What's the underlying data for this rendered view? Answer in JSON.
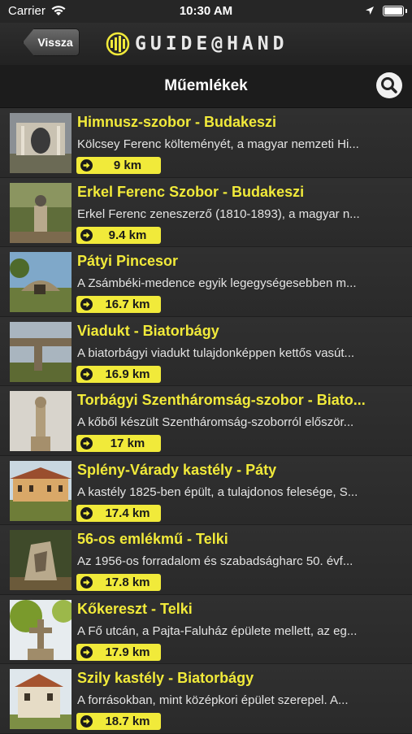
{
  "status": {
    "carrier": "Carrier",
    "time": "10:30 AM"
  },
  "nav": {
    "back_label": "Vissza",
    "logo_text": "GUIDE@HAND"
  },
  "header": {
    "title": "Műemlékek"
  },
  "items": [
    {
      "title": "Himnusz-szobor - Budakeszi",
      "desc": "Kölcsey Ferenc költeményét, a magyar nemzeti Hi...",
      "distance": "9 km"
    },
    {
      "title": "Erkel Ferenc Szobor - Budakeszi",
      "desc": "Erkel Ferenc zeneszerző (1810-1893), a magyar n...",
      "distance": "9.4 km"
    },
    {
      "title": "Pátyi Pincesor",
      "desc": "A Zsámbéki-medence egyik legegységesebben m...",
      "distance": "16.7 km"
    },
    {
      "title": "Viadukt - Biatorbágy",
      "desc": "A biatorbágyi viadukt tulajdonképpen kettős vasút...",
      "distance": "16.9 km"
    },
    {
      "title": "Torbágyi Szentháromság-szobor  - Biato...",
      "desc": "A kőből készült Szentháromság-szoborról először...",
      "distance": "17 km"
    },
    {
      "title": "Splény-Várady kastély - Páty",
      "desc": "A kastély 1825-ben épült, a tulajdonos felesége, S...",
      "distance": "17.4 km"
    },
    {
      "title": "56-os emlékmű - Telki",
      "desc": "Az 1956-os forradalom és szabadságharc 50. évf...",
      "distance": "17.8 km"
    },
    {
      "title": "Kőkereszt - Telki",
      "desc": "A Fő utcán, a Pajta-Faluház épülete mellett, az eg...",
      "distance": "17.9 km"
    },
    {
      "title": "Szily kastély - Biatorbágy",
      "desc": "A forrásokban, mint középkori épület szerepel. A...",
      "distance": "18.7 km"
    }
  ],
  "colors": {
    "accent": "#f1ea3a",
    "background": "#2b2b2b"
  }
}
